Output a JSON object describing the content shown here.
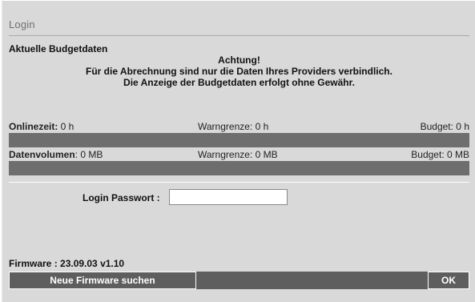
{
  "header": {
    "title": "Login"
  },
  "budget": {
    "section_title": "Aktuelle Budgetdaten",
    "notice_lines": [
      "Achtung!",
      "Für die Abrechnung sind nur die Daten Ihres Providers verbindlich.",
      "Die Anzeige der Budgetdaten erfolgt ohne Gewähr."
    ],
    "online": {
      "label": "Onlinezeit:",
      "value": " 0 h",
      "warn": "Warngrenze: 0 h",
      "budget": "Budget: 0 h",
      "progress": 0
    },
    "volume": {
      "label": "Datenvolumen",
      "value": ": 0 MB",
      "warn": "Warngrenze: 0 MB",
      "budget": "Budget: 0 MB",
      "progress": 0
    }
  },
  "login": {
    "password_label": "Login Passwort :",
    "password_value": ""
  },
  "footer": {
    "firmware": "Firmware : 23.09.03 v1.10",
    "search_button": "Neue Firmware suchen",
    "ok_button": "OK"
  },
  "colors": {
    "background": "#d9d9d9",
    "bar": "#6e6e6e",
    "footer_bar": "#5e5e5e"
  }
}
